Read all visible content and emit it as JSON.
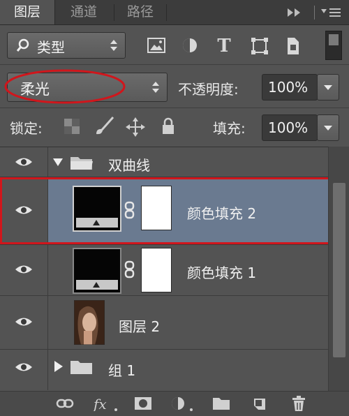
{
  "tabs": [
    {
      "label": "图层",
      "active": true
    },
    {
      "label": "通道",
      "active": false
    },
    {
      "label": "路径",
      "active": false
    }
  ],
  "filter": {
    "label": "类型"
  },
  "blend": {
    "mode": "柔光",
    "opacity_label": "不透明度:",
    "opacity_value": "100%"
  },
  "lock": {
    "label": "锁定:",
    "fill_label": "填充:",
    "fill_value": "100%"
  },
  "layers": [
    {
      "name": "双曲线",
      "type": "group-open"
    },
    {
      "name": "颜色填充 2",
      "type": "fill",
      "selected": true
    },
    {
      "name": "颜色填充 1",
      "type": "fill",
      "selected": false
    },
    {
      "name": "图层 2",
      "type": "image"
    },
    {
      "name": "组 1",
      "type": "group-closed"
    }
  ],
  "bottom_icons": [
    "link-icon",
    "fx-icon",
    "mask-icon",
    "adjustment-icon",
    "folder-icon",
    "new-layer-icon",
    "trash-icon"
  ],
  "colors": {
    "panel_bg": "#535353",
    "selection": "#6a7a90",
    "highlight": "#d0161c"
  }
}
